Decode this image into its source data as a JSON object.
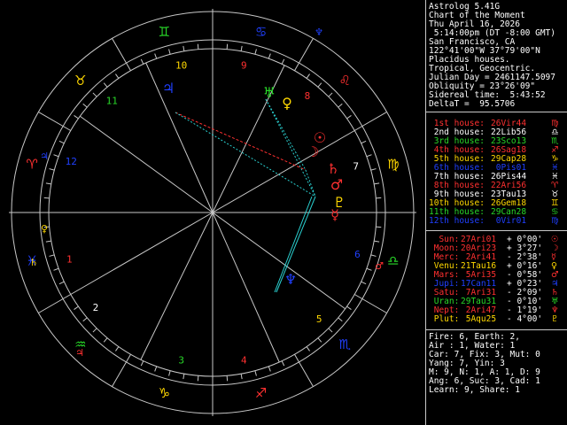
{
  "header": {
    "program": "Astrolog 5.41G",
    "chart": "Chart of the Moment",
    "date": "Thu April 16, 2026",
    "time": " 5:14:00pm (DT -8:00 GMT)",
    "place": "San Francisco, CA",
    "coords": "122°41'00\"W 37°79'00\"N",
    "houses": "Placidus houses.",
    "zodiac": "Tropical, Geocentric.",
    "julian": "Julian Day = 2461147.5097",
    "obliquity": "Obliquity = 23°26'09\"",
    "sidereal": "Sidereal time:  5:43:52",
    "delta": "DeltaT =  95.5706"
  },
  "house_cusps": [
    {
      "label": " 1st house:",
      "value": "26Vir44",
      "glyph": "♍",
      "color": "#ff3030"
    },
    {
      "label": " 2nd house:",
      "value": "22Lib56",
      "glyph": "♎",
      "color": "#ffffff"
    },
    {
      "label": " 3rd house:",
      "value": "23Sco13",
      "glyph": "♏",
      "color": "#28d828"
    },
    {
      "label": " 4th house:",
      "value": "26Sag18",
      "glyph": "♐",
      "color": "#ff3030"
    },
    {
      "label": " 5th house:",
      "value": "29Cap28",
      "glyph": "♑",
      "color": "#ffd800"
    },
    {
      "label": " 6th house:",
      "value": " 0Pis01",
      "glyph": "♓",
      "color": "#2040ff"
    },
    {
      "label": " 7th house:",
      "value": "26Pis44",
      "glyph": "♓",
      "color": "#ffffff"
    },
    {
      "label": " 8th house:",
      "value": "22Ari56",
      "glyph": "♈",
      "color": "#ff3030"
    },
    {
      "label": " 9th house:",
      "value": "23Tau13",
      "glyph": "♉",
      "color": "#ffffff"
    },
    {
      "label": "10th house:",
      "value": "26Gem18",
      "glyph": "♊",
      "color": "#ffd800"
    },
    {
      "label": "11th house:",
      "value": "29Can28",
      "glyph": "♋",
      "color": "#28d828"
    },
    {
      "label": "12th house:",
      "value": " 0Vir01",
      "glyph": "♍",
      "color": "#2040ff"
    }
  ],
  "planets": [
    {
      "label": "  Sun:",
      "pos": "27Ari01",
      "lat": "+ 0°00'",
      "glyph": "☉",
      "color": "#ff3030"
    },
    {
      "label": " Moon:",
      "pos": "20Ari23",
      "lat": "+ 3°27'",
      "glyph": "☽",
      "color": "#ff3030"
    },
    {
      "label": " Merc:",
      "pos": " 2Ari41",
      "lat": "- 2°38'",
      "glyph": "☿",
      "color": "#ff3030"
    },
    {
      "label": " Venu:",
      "pos": "21Tau16",
      "lat": "+ 0°16'",
      "glyph": "♀",
      "color": "#ffd800"
    },
    {
      "label": " Mars:",
      "pos": " 5Ari35",
      "lat": "- 0°58'",
      "glyph": "♂",
      "color": "#ff3030"
    },
    {
      "label": " Jupi:",
      "pos": "17Can11",
      "lat": "+ 0°23'",
      "glyph": "♃",
      "color": "#2040ff"
    },
    {
      "label": " Satu:",
      "pos": " 7Ari31",
      "lat": "- 2°09'",
      "glyph": "♄",
      "color": "#ff3030"
    },
    {
      "label": " Uran:",
      "pos": "29Tau31",
      "lat": "- 0°10'",
      "glyph": "♅",
      "color": "#28d828"
    },
    {
      "label": " Nept:",
      "pos": " 2Ari47",
      "lat": "- 1°19'",
      "glyph": "♆",
      "color": "#ff3030"
    },
    {
      "label": " Plut:",
      "pos": " 5Aqu25",
      "lat": "- 4°00'",
      "glyph": "♇",
      "color": "#ffd800"
    }
  ],
  "summary": [
    "Fire: 6, Earth: 2,",
    "Air : 1, Water: 1",
    "Car: 7, Fix: 3, Mut: 0",
    "Yang: 7, Yin: 3",
    "M: 9, N: 1, A: 1, D: 9",
    "Ang: 6, Suc: 3, Cad: 1",
    "Learn: 9, Share: 1"
  ],
  "wheel": {
    "signs": [
      {
        "glyph": "♈",
        "color": "#ff3030"
      },
      {
        "glyph": "♉",
        "color": "#ffd800"
      },
      {
        "glyph": "♊",
        "color": "#28d828"
      },
      {
        "glyph": "♋",
        "color": "#2040ff"
      },
      {
        "glyph": "♌",
        "color": "#ff3030"
      },
      {
        "glyph": "♍",
        "color": "#ffd800"
      },
      {
        "glyph": "♎",
        "color": "#28d828"
      },
      {
        "glyph": "♏",
        "color": "#2040ff"
      },
      {
        "glyph": "♐",
        "color": "#ff3030"
      },
      {
        "glyph": "♑",
        "color": "#ffd800"
      },
      {
        "glyph": "♒",
        "color": "#28d828"
      },
      {
        "glyph": "♓",
        "color": "#2040ff"
      }
    ],
    "house_numbers": [
      "1",
      "2",
      "3",
      "4",
      "5",
      "6",
      "7",
      "8",
      "9",
      "10",
      "11",
      "12"
    ],
    "planet_glyphs": [
      {
        "glyph": "☉",
        "color": "#ff3030"
      },
      {
        "glyph": "☽",
        "color": "#ff3030"
      },
      {
        "glyph": "☿",
        "color": "#ff3030"
      },
      {
        "glyph": "♀",
        "color": "#ffd800"
      },
      {
        "glyph": "♂",
        "color": "#ff3030"
      },
      {
        "glyph": "♃",
        "color": "#2040ff"
      },
      {
        "glyph": "♄",
        "color": "#ff3030"
      },
      {
        "glyph": "♅",
        "color": "#28d828"
      },
      {
        "glyph": "♆",
        "color": "#2040ff"
      },
      {
        "glyph": "♇",
        "color": "#ffd800"
      }
    ],
    "cusp_ruler_glyphs": [
      {
        "glyph": "♀",
        "color": "#ffd800"
      },
      {
        "glyph": "♂",
        "color": "#ff3030"
      },
      {
        "glyph": "♃",
        "color": "#ff3030"
      },
      {
        "glyph": "♄",
        "color": "#ffd800"
      },
      {
        "glyph": "♃",
        "color": "#2040ff"
      },
      {
        "glyph": "♆",
        "color": "#2040ff"
      }
    ]
  }
}
